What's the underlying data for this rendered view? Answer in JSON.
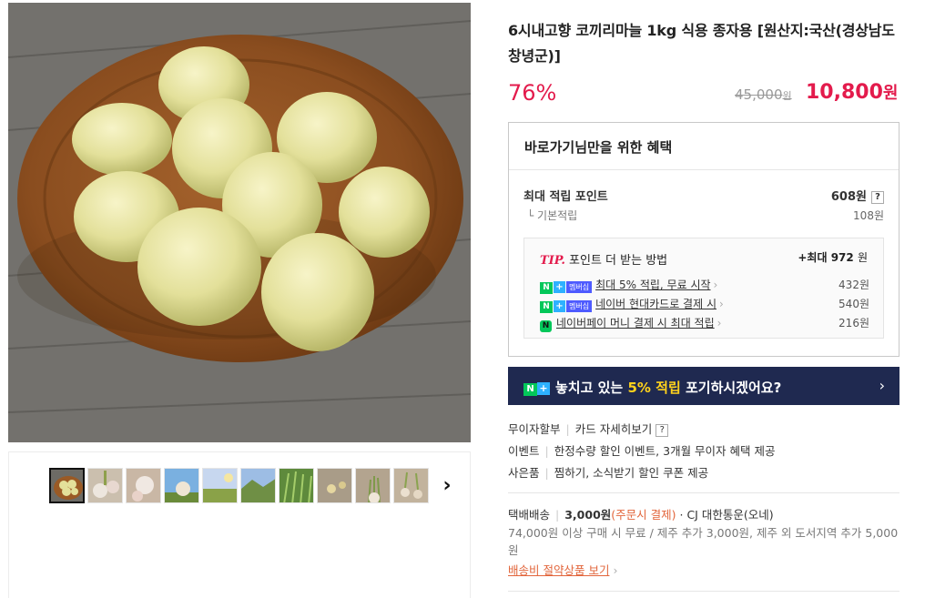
{
  "product": {
    "title": "6시내고향 코끼리마늘 1kg 식용 종자용 [원산지:국산(경상남도 창녕군)]",
    "discount_rate": "76%",
    "original_price": "45,000",
    "original_price_unit": "원",
    "sale_price": "10,800",
    "sale_price_unit": "원"
  },
  "gallery": {
    "next_icon": "chevron-right-icon",
    "thumbnail_count": 10
  },
  "benefits": {
    "heading": "바로가기님만을 위한 혜택",
    "max_points_label": "최대 적립 포인트",
    "max_points_value": "608원",
    "help_label": "?",
    "base_points_label": "└ 기본적립",
    "base_points_value": "108원",
    "tip": {
      "tip_label": "TIP.",
      "title": "포인트 더 받는 방법",
      "max_prefix": "+최대",
      "max_value": "972",
      "max_unit": "원",
      "items": [
        {
          "text": "최대 5% 적립, 무료 시작",
          "value": "432원",
          "badge": "membership"
        },
        {
          "text": "네이버 현대카드로 결제 시",
          "value": "540원",
          "badge": "membership"
        },
        {
          "text": "네이버페이 머니 결제 시 최대 적립",
          "value": "216원",
          "badge": "pay"
        }
      ],
      "badge_n": "N",
      "badge_plus": "+",
      "badge_mem": "멤버십",
      "badge_pay": "N"
    }
  },
  "banner": {
    "text_before": "놓치고 있는 ",
    "highlight": "5% 적립",
    "text_after": " 포기하시겠어요?",
    "chevron": "›"
  },
  "info_rows": {
    "installment_label": "무이자할부",
    "installment_link": "카드 자세히보기",
    "event_label": "이벤트",
    "event_text": "한정수량 할인 이벤트, 3개월 무이자 혜택 제공",
    "gift_label": "사은품",
    "gift_text": "찜하기, 소식받기 할인 쿠폰 제공"
  },
  "shipping": {
    "label": "택배배송",
    "fee": "3,000원",
    "fee_note": "(주문시 결제)",
    "courier": "· CJ 대한통운(오네)",
    "details": "74,000원 이상 구매 시 무료 / 제주 추가 3,000원, 제주 외 도서지역 추가 5,000원",
    "saving_link": "배송비 절약상품 보기",
    "saving_arrow": "›"
  },
  "colors": {
    "accent_red": "#e31b4c",
    "banner_bg": "#1f2950",
    "naver_green": "#03c75a",
    "highlight_yellow": "#ffd21c"
  }
}
